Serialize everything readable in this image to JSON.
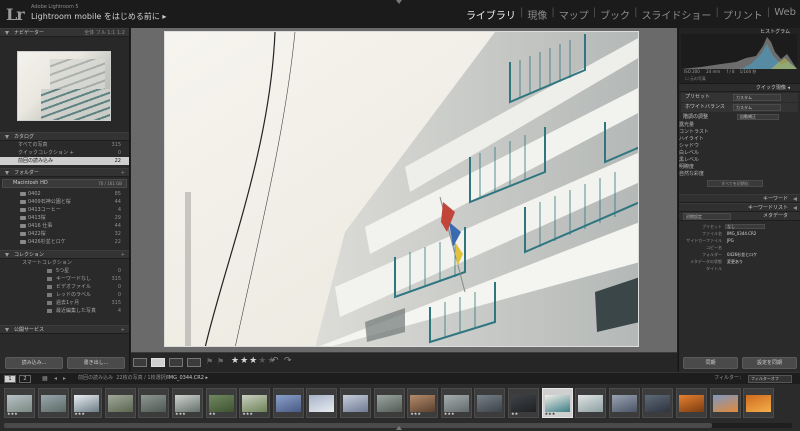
{
  "app": {
    "logo": "Lr",
    "product": "Adobe Lightroom 5",
    "mobile_prompt": "Lightroom mobile をはじめる前に ▸"
  },
  "modules": [
    {
      "label": "ライブラリ",
      "selected": true
    },
    {
      "label": "現像",
      "selected": false
    },
    {
      "label": "マップ",
      "selected": false
    },
    {
      "label": "ブック",
      "selected": false
    },
    {
      "label": "スライドショー",
      "selected": false
    },
    {
      "label": "プリント",
      "selected": false
    },
    {
      "label": "Web",
      "selected": false
    }
  ],
  "left_panel": {
    "navigator": {
      "title": "ナビゲーター",
      "zoom_options": "全体  フル  1:1  1:2"
    },
    "catalog": {
      "title": "カタログ",
      "items": [
        {
          "label": "すべての写真",
          "count": "315"
        },
        {
          "label": "クイックコレクション +",
          "count": "0"
        },
        {
          "label": "前回の読み込み",
          "count": "22",
          "selected": true
        }
      ]
    },
    "folders": {
      "title": "フォルダー",
      "volume": {
        "label": "Macintosh HD",
        "usage": "70 / 161 GB"
      },
      "items": [
        {
          "label": "0402",
          "count": "85"
        },
        {
          "label": "0409石神公園と桜",
          "count": "44"
        },
        {
          "label": "0413コーヒー",
          "count": "4"
        },
        {
          "label": "0413桜",
          "count": "29"
        },
        {
          "label": "0416 仕事",
          "count": "44"
        },
        {
          "label": "0422桜",
          "count": "32"
        },
        {
          "label": "0426杉並とロケ",
          "count": "22"
        }
      ]
    },
    "collections": {
      "title": "コレクション",
      "smart_label": "スマートコレクション",
      "items": [
        {
          "label": "5つ星",
          "count": "0"
        },
        {
          "label": "キーワードなし",
          "count": "315"
        },
        {
          "label": "ビデオファイル",
          "count": "0"
        },
        {
          "label": "レッドのラベル",
          "count": "0"
        },
        {
          "label": "過去1ヶ月",
          "count": "315"
        },
        {
          "label": "最近編集した写真",
          "count": "4"
        }
      ]
    },
    "publish": {
      "title": "公開サービス"
    },
    "import_button": "読み込み...",
    "export_button": "書き出し..."
  },
  "right_panel": {
    "histogram": {
      "title": "ヒストグラム",
      "iso": "ISO 200",
      "focal": "24 mm",
      "aperture": "f / 8",
      "shutter": "1/160 秒",
      "original_label": "元の写真"
    },
    "quick_develop": {
      "title": "クイック現像",
      "preset_label": "プリセット",
      "preset_value": "カスタム",
      "wb_label": "ホワイトバランス",
      "wb_value": "カスタム",
      "tone_label": "階調の調整",
      "tone_value": "自動補正",
      "tone_rows": [
        "露光量",
        "コントラスト",
        "ハイライト",
        "シャドウ",
        "白レベル",
        "黒レベル",
        "明瞭度",
        "自然な彩度"
      ],
      "reset_button": "すべてを初期化"
    },
    "keywords_title": "キーワード",
    "keyword_list_title": "キーワードリスト",
    "metadata": {
      "title": "メタデータ",
      "preset_value": "初期設定",
      "preset_label": "プリセット",
      "preset_select": "なし",
      "rows": [
        {
          "key": "ファイル名",
          "value": "IMG_0344.CR2"
        },
        {
          "key": "サイドカーファイル",
          "value": "JPG"
        },
        {
          "key": "コピー名",
          "value": ""
        },
        {
          "key": "フォルダー",
          "value": "0426杉並とロケ"
        },
        {
          "key": "メタデータの状態",
          "value": "変更あり"
        },
        {
          "key": "タイトル",
          "value": ""
        }
      ]
    },
    "sync_button": "同期",
    "sync_settings_button": "設定を同期"
  },
  "toolbar": {
    "rating_on": "★★★",
    "rating_off": "★★"
  },
  "filmstrip_bar": {
    "page1": "1",
    "page2": "2",
    "source": "前回の読み込み",
    "info": "22枚の写真 / 1枚選択",
    "filename": "/IMG_0344.CR2 ▸",
    "filter_label": "フィルター：",
    "filter_value": "フィルターオフ"
  },
  "filmstrip": {
    "thumbs": [
      {
        "colors": [
          "#b8c1c7",
          "#7a8a82"
        ],
        "rating": "★★★"
      },
      {
        "colors": [
          "#9aa6ad",
          "#5c6a66"
        ],
        "rating": ""
      },
      {
        "colors": [
          "#e8eef2",
          "#6c7c86"
        ],
        "rating": "★★★"
      },
      {
        "colors": [
          "#a2a79a",
          "#5a6650"
        ],
        "rating": ""
      },
      {
        "colors": [
          "#8f9692",
          "#4d5a53"
        ],
        "rating": ""
      },
      {
        "colors": [
          "#cfd3cf",
          "#63706a"
        ],
        "rating": "★★★"
      },
      {
        "colors": [
          "#6f8a5e",
          "#3f5232"
        ],
        "rating": "★★"
      },
      {
        "colors": [
          "#c8cfbf",
          "#6e8358"
        ],
        "rating": "★★★"
      },
      {
        "colors": [
          "#8aa1c8",
          "#4a5a86"
        ],
        "rating": ""
      },
      {
        "colors": [
          "#a6b2c8",
          "#e8ecf0"
        ],
        "rating": ""
      },
      {
        "colors": [
          "#c7cedb",
          "#6f7a92"
        ],
        "rating": ""
      },
      {
        "colors": [
          "#9ca5a0",
          "#535c57"
        ],
        "rating": ""
      },
      {
        "colors": [
          "#b58c6a",
          "#5a4030"
        ],
        "rating": "★★★"
      },
      {
        "colors": [
          "#a7adae",
          "#616a6c"
        ],
        "rating": "★★★"
      },
      {
        "colors": [
          "#77808a",
          "#3c4248"
        ],
        "rating": ""
      },
      {
        "colors": [
          "#3f4347",
          "#1f2124"
        ],
        "rating": "★★"
      },
      {
        "colors": [
          "#f1efe8",
          "#3c7d86"
        ],
        "rating": "★★★",
        "selected": true
      },
      {
        "colors": [
          "#dfe3e2",
          "#8ea0a3"
        ],
        "rating": ""
      },
      {
        "colors": [
          "#9aa3b0",
          "#4a5568"
        ],
        "rating": ""
      },
      {
        "colors": [
          "#5f6a78",
          "#2e3440"
        ],
        "rating": ""
      },
      {
        "colors": [
          "#e6812f",
          "#7a3b12"
        ],
        "rating": ""
      },
      {
        "colors": [
          "#7f97c0",
          "#e08a3c"
        ],
        "rating": ""
      },
      {
        "colors": [
          "#d06a1e",
          "#f2b04a"
        ],
        "rating": ""
      }
    ]
  }
}
